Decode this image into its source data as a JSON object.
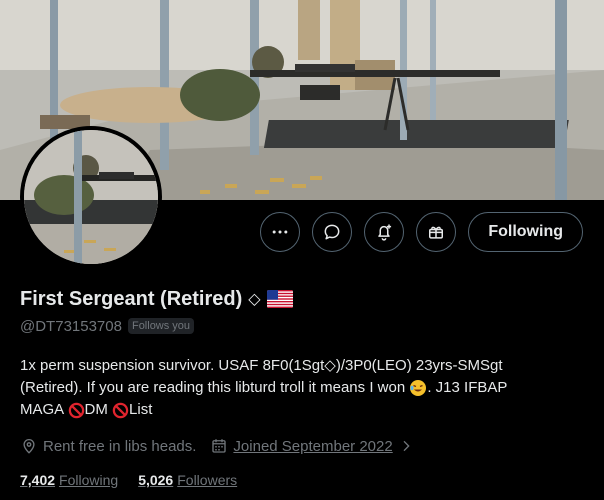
{
  "profile": {
    "display_name": "First Sergeant (Retired)",
    "verified_glyph": "◇",
    "flag_emoji": "us-flag",
    "handle": "@DT73153708",
    "follows_you_badge": "Follows you",
    "bio_parts": {
      "line1": "1x perm suspension survivor. USAF 8F0(1Sgt◇)/3P0(LEO) 23yrs-SMSgt",
      "line2a": "(Retired). If you are reading this libturd troll it means I won ",
      "line2b": ". J13 IFBAP",
      "line3a": "MAGA ",
      "line3b": "DM ",
      "line3c": "List"
    },
    "location": "Rent free in libs heads.",
    "joined": "Joined September 2022",
    "following_count": "7,402",
    "following_label": "Following",
    "followers_count": "5,026",
    "followers_label": "Followers"
  },
  "actions": {
    "more_icon": "more-icon",
    "message_icon": "message-icon",
    "notify_icon": "bell-plus-icon",
    "gift_icon": "gift-icon",
    "follow_label": "Following"
  },
  "colors": {
    "background": "#000000",
    "primary_text": "#e7e9ea",
    "secondary_text": "#71767b",
    "border": "#536471"
  }
}
